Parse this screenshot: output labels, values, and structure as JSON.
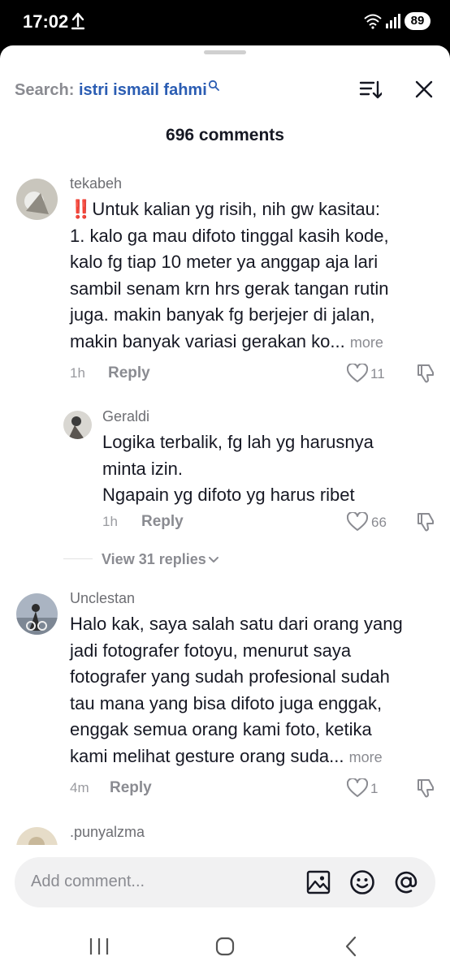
{
  "status_bar": {
    "time": "17:02",
    "battery": "89"
  },
  "header": {
    "search_prefix": "Search:",
    "search_term": "istri ismail fahmi",
    "comment_count": "696 comments"
  },
  "comments": [
    {
      "username": "tekabeh",
      "text_lines": [
        "‼️Untuk kalian yg risih, nih gw kasitau:",
        "1. kalo ga mau difoto tinggal kasih kode,",
        "kalo fg tiap 10 meter ya anggap aja lari",
        "sambil senam krn hrs gerak tangan rutin",
        "juga. makin banyak fg berjejer di jalan,",
        "makin banyak variasi gerakan ko..."
      ],
      "more_label": "more",
      "time": "1h",
      "reply_label": "Reply",
      "likes": "11",
      "reply": {
        "username": "Geraldi",
        "text_lines": [
          "Logika terbalik, fg lah yg harusnya",
          "minta izin.",
          "Ngapain yg difoto yg harus ribet"
        ],
        "time": "1h",
        "reply_label": "Reply",
        "likes": "66"
      },
      "view_replies": "View 31 replies"
    },
    {
      "username": "Unclestan",
      "text_lines": [
        "Halo kak, saya salah satu dari orang yang",
        "jadi fotografer fotoyu, menurut saya",
        "fotografer yang sudah profesional sudah",
        "tau mana yang bisa difoto juga enggak,",
        "enggak semua orang kami foto, ketika",
        "kami melihat gesture orang suda..."
      ],
      "more_label": "more",
      "time": "4m",
      "reply_label": "Reply",
      "likes": "1"
    },
    {
      "username": ".punyalzma"
    }
  ],
  "input": {
    "placeholder": "Add comment..."
  },
  "icons": {
    "upload": "upload-icon",
    "wifi": "wifi-icon",
    "signal": "signal-icon",
    "sort": "sort-icon",
    "close": "close-icon",
    "heart": "heart-icon",
    "dislike": "dislike-icon",
    "image": "image-icon",
    "emoji": "emoji-icon",
    "mention": "at-icon"
  },
  "colors": {
    "search_term": "#2b5db3",
    "text": "#161823",
    "muted": "#8a8b91",
    "background": "#ffffff"
  }
}
